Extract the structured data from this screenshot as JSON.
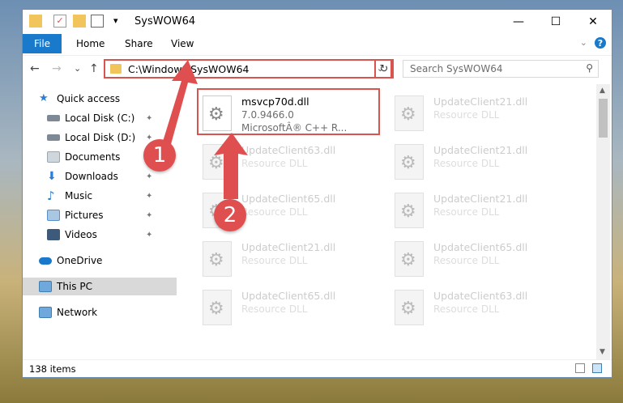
{
  "window": {
    "title": "SysWOW64",
    "qa_dropdown": "▾",
    "minimize": "—",
    "maximize": "☐",
    "close": "✕"
  },
  "ribbon": {
    "tabs": [
      "File",
      "Home",
      "Share",
      "View"
    ],
    "help": "?",
    "collapse": "⌄"
  },
  "nav": {
    "back": "←",
    "forward": "→",
    "recent": "⌄",
    "up": "↑",
    "address": "C:\\Windows\\SysWOW64",
    "address_dropdown": "⌄",
    "refresh": "↻",
    "search_placeholder": "Search SysWOW64",
    "search_icon": "⚲"
  },
  "sidebar": [
    {
      "label": "Quick access",
      "icon": "star-icon",
      "color": "#2a7fd4",
      "pinned": false
    },
    {
      "label": "Local Disk (C:)",
      "icon": "drive-icon",
      "color": "#7d8a96",
      "pinned": true
    },
    {
      "label": "Local Disk (D:)",
      "icon": "drive-icon",
      "color": "#7d8a96",
      "pinned": true
    },
    {
      "label": "Documents",
      "icon": "documents-icon",
      "color": "#9aa6b0",
      "pinned": true
    },
    {
      "label": "Downloads",
      "icon": "downloads-icon",
      "color": "#2a7fd4",
      "pinned": true
    },
    {
      "label": "Music",
      "icon": "music-icon",
      "color": "#2a7fd4",
      "pinned": true
    },
    {
      "label": "Pictures",
      "icon": "pictures-icon",
      "color": "#5a8fc4",
      "pinned": true
    },
    {
      "label": "Videos",
      "icon": "videos-icon",
      "color": "#3d5a7a",
      "pinned": true
    },
    {
      "label": "OneDrive",
      "icon": "cloud-icon",
      "color": "#1979ca",
      "pinned": false
    },
    {
      "label": "This PC",
      "icon": "computer-icon",
      "color": "#3c7fb1",
      "pinned": false,
      "selected": true
    },
    {
      "label": "Network",
      "icon": "network-icon",
      "color": "#3c7fb1",
      "pinned": false
    }
  ],
  "pin_glyph": "📌",
  "files": [
    {
      "name": "msvcp70d.dll",
      "desc": "7.0.9466.0",
      "desc2": "MicrosoftÂ® C++ R...",
      "active": true
    },
    {
      "name": "UpdateClient21.dll",
      "desc": "Resource DLL"
    },
    {
      "name": "UpdateClient63.dll",
      "desc": "Resource DLL"
    },
    {
      "name": "UpdateClient21.dll",
      "desc": "Resource DLL"
    },
    {
      "name": "UpdateClient65.dll",
      "desc": "Resource DLL"
    },
    {
      "name": "UpdateClient21.dll",
      "desc": "Resource DLL"
    },
    {
      "name": "UpdateClient21.dll",
      "desc": "Resource DLL"
    },
    {
      "name": "UpdateClient65.dll",
      "desc": "Resource DLL"
    },
    {
      "name": "UpdateClient65.dll",
      "desc": "Resource DLL"
    },
    {
      "name": "UpdateClient63.dll",
      "desc": "Resource DLL"
    }
  ],
  "status": {
    "count": "138 items"
  },
  "annotations": {
    "step1": "1",
    "step2": "2",
    "color": "#e04f4f"
  }
}
